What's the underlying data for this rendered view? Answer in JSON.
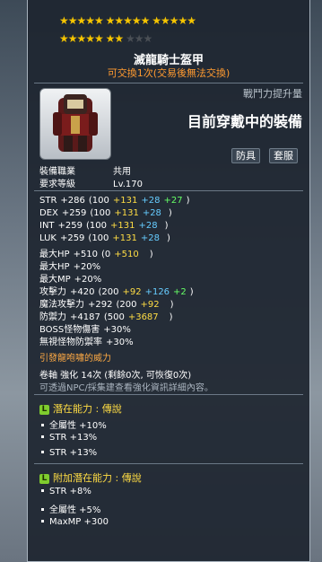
{
  "stars": {
    "row1": "★★★★★ ★★★★★ ★★★★★",
    "row2_on": "★★★★★ ★★",
    "row2_off": "★★★"
  },
  "item": {
    "name": "滅龍騎士盔甲",
    "trade_note": "可交換1次(交易後無法交換)",
    "power_label": "戰鬥力提升量",
    "wearing_label": "目前穿戴中的裝備",
    "tags": [
      "防具",
      "套服"
    ],
    "job_label": "裝備職業",
    "job_value": "共用",
    "level_label": "要求等級",
    "level_value": "Lv.170"
  },
  "stats": [
    {
      "name": "STR",
      "base": "+286",
      "open": "(100",
      "yellow": "+131",
      "cyan": "+28",
      "green": "+27",
      "close": ")"
    },
    {
      "name": "DEX",
      "base": "+259",
      "open": "(100",
      "yellow": "+131",
      "cyan": "+28",
      "green": "",
      "close": ")"
    },
    {
      "name": "INT",
      "base": "+259",
      "open": "(100",
      "yellow": "+131",
      "cyan": "+28",
      "green": "",
      "close": ")"
    },
    {
      "name": "LUK",
      "base": "+259",
      "open": "(100",
      "yellow": "+131",
      "cyan": "+28",
      "green": "",
      "close": ")"
    },
    {
      "name": "最大HP",
      "base": "+510",
      "open": "(0",
      "yellow": "+510",
      "cyan": "",
      "green": "",
      "close": ")"
    },
    {
      "name": "最大HP",
      "base": "+20%",
      "open": "",
      "yellow": "",
      "cyan": "",
      "green": "",
      "close": ""
    },
    {
      "name": "最大MP",
      "base": "+20%",
      "open": "",
      "yellow": "",
      "cyan": "",
      "green": "",
      "close": ""
    },
    {
      "name": "攻擊力",
      "base": "+420",
      "open": "(200",
      "yellow": "+92",
      "cyan": "+126",
      "green": "+2",
      "close": ")"
    },
    {
      "name": "魔法攻擊力",
      "base": "+292",
      "open": "(200",
      "yellow": "+92",
      "cyan": "",
      "green": "",
      "close": ")"
    },
    {
      "name": "防禦力",
      "base": "+4187",
      "open": "(500",
      "yellow": "+3687",
      "cyan": "",
      "green": "",
      "close": ")"
    },
    {
      "name": "BOSS怪物傷害",
      "base": "+30%",
      "open": "",
      "yellow": "",
      "cyan": "",
      "green": "",
      "close": ""
    },
    {
      "name": "無視怪物防禦率",
      "base": "+30%",
      "open": "",
      "yellow": "",
      "cyan": "",
      "green": "",
      "close": ""
    }
  ],
  "roar": "引發龍咆嘯的威力",
  "scroll": {
    "line": "卷軸 強化 14次 (剩餘0次, 可恢復0次)",
    "hint": "可透過NPC/採集建查看強化資訊詳細內容。"
  },
  "potential": {
    "title": "潛在能力 : 傳說",
    "lines": [
      "全屬性 +10%",
      "STR +13%",
      "STR +13%"
    ]
  },
  "bonus": {
    "title": "附加潛在能力 : 傳說",
    "lines": [
      "STR +8%",
      "全屬性 +5%",
      "MaxMP +300"
    ]
  },
  "badge_letter": "L"
}
